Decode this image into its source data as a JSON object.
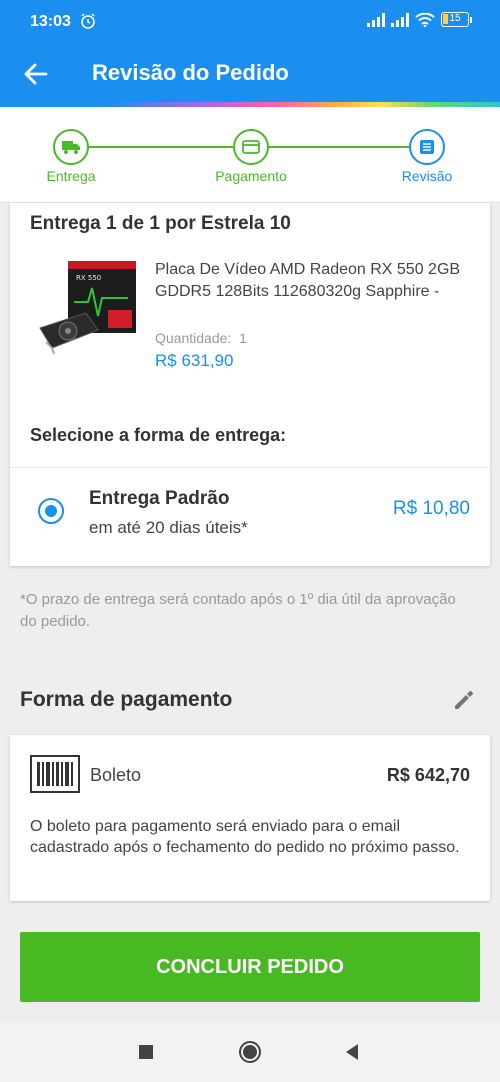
{
  "status": {
    "time": "13:03",
    "battery": "15"
  },
  "header": {
    "title": "Revisão do Pedido"
  },
  "stepper": {
    "steps": [
      {
        "label": "Entrega"
      },
      {
        "label": "Pagamento"
      },
      {
        "label": "Revisão"
      }
    ]
  },
  "delivery": {
    "title": "Entrega 1 de 1 por Estrela 10",
    "product": {
      "name": "Placa De Vídeo AMD Radeon RX 550 2GB GDDR5 128Bits 112680320g Sapphire -",
      "quantity_label": "Quantidade:",
      "quantity": "1",
      "price": "R$ 631,90"
    },
    "select_title": "Selecione a forma de entrega:",
    "option": {
      "name": "Entrega Padrão",
      "days": "em até 20 dias úteis*",
      "price": "R$ 10,80"
    }
  },
  "note": "*O prazo de entrega será contado após o 1º dia útil da aprovação do pedido.",
  "payment": {
    "header": "Forma de pagamento",
    "method": "Boleto",
    "total": "R$ 642,70",
    "description": "O boleto para pagamento será enviado para o email cadastrado após o fechamento do pedido no próximo passo."
  },
  "cta": {
    "label": "CONCLUIR PEDIDO"
  },
  "colors": {
    "primary": "#1a8ff0",
    "success": "#48b923"
  }
}
